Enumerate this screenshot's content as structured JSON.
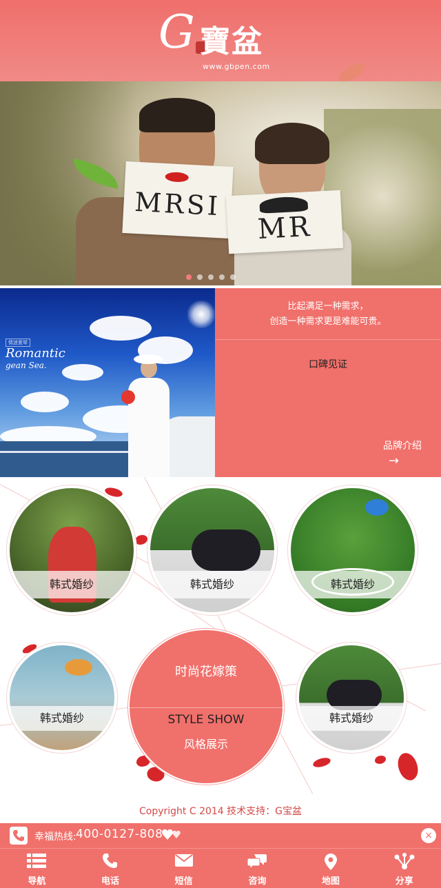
{
  "header": {
    "logo_letter": "G",
    "logo_cn": "寶盆",
    "logo_url": "www.gbpen.com"
  },
  "banner": {
    "sign_left": "MRSI",
    "sign_right": "MR",
    "slide_count": 5,
    "active_slide": 1
  },
  "intro": {
    "photo_tag": "情迷爱琴",
    "photo_title": "Romantic",
    "photo_sub": "gean Sea.",
    "quote_line1": "比起满足一种需求，",
    "quote_line2": "创造一种需求更是难能可贵。",
    "koubei": "口碑见证",
    "brand_link": "品牌介绍",
    "brand_arrow": "→"
  },
  "styles": {
    "items": [
      {
        "label": "韩式婚纱"
      },
      {
        "label": "韩式婚纱"
      },
      {
        "label": "韩式婚纱"
      },
      {
        "label": "韩式婚纱"
      },
      {
        "label": "韩式婚纱"
      }
    ],
    "center_title": "时尚花嫁策",
    "center_en": "STYLE SHOW",
    "center_cn": "风格展示"
  },
  "footer": {
    "copyright": "Copyright C 2014 技术支持：G宝盆"
  },
  "hotline": {
    "label": "幸福热线:",
    "number": "400-0127-808",
    "close": "×"
  },
  "bottom_nav": {
    "items": [
      {
        "label": "导航",
        "icon": "list-icon"
      },
      {
        "label": "电话",
        "icon": "phone-icon"
      },
      {
        "label": "短信",
        "icon": "envelope-icon"
      },
      {
        "label": "咨询",
        "icon": "chat-icon"
      },
      {
        "label": "地图",
        "icon": "map-pin-icon"
      },
      {
        "label": "分享",
        "icon": "share-icon"
      }
    ]
  },
  "colors": {
    "primary": "#f0706b",
    "accent_red": "#d7262a",
    "copyright_text": "#d24a47"
  }
}
